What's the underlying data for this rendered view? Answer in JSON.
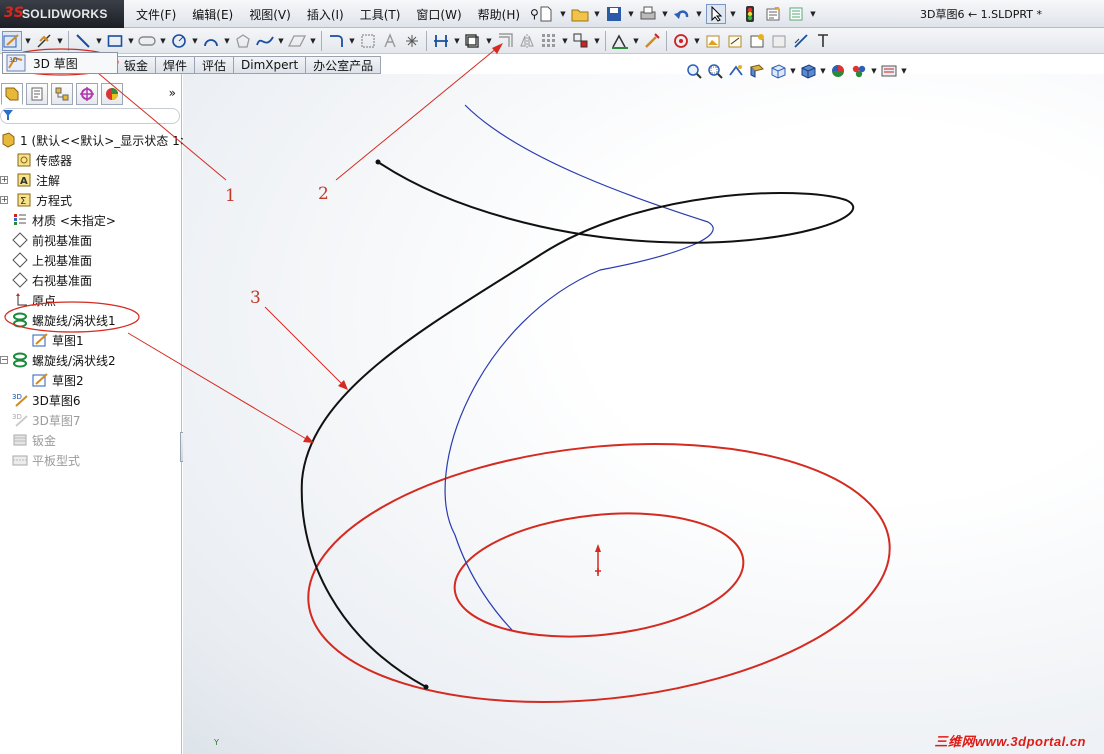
{
  "app": {
    "logo_ds": "3S",
    "logo_name": "SOLIDWORKS",
    "document_title": "3D草图6 ← 1.SLDPRT *"
  },
  "menu": {
    "items": [
      "文件(F)",
      "编辑(E)",
      "视图(V)",
      "插入(I)",
      "工具(T)",
      "窗口(W)",
      "帮助(H)"
    ]
  },
  "sketch_popup": {
    "label": "3D 草图"
  },
  "command_tabs": [
    "钣金",
    "焊件",
    "评估",
    "DimXpert",
    "办公室产品"
  ],
  "feature_tree": {
    "root": "1  (默认<<默认>_显示状态 1>",
    "items": [
      {
        "label": "传感器",
        "icon": "sensor-icon"
      },
      {
        "label": "注解",
        "icon": "annotation-icon"
      },
      {
        "label": "方程式",
        "icon": "equation-icon"
      },
      {
        "label": "材质 <未指定>",
        "icon": "material-icon"
      },
      {
        "label": "前视基准面",
        "icon": "plane-icon"
      },
      {
        "label": "上视基准面",
        "icon": "plane-icon"
      },
      {
        "label": "右视基准面",
        "icon": "plane-icon"
      },
      {
        "label": "原点",
        "icon": "origin-icon"
      },
      {
        "label": "螺旋线/涡状线1",
        "icon": "helix-icon"
      },
      {
        "label": "草图1",
        "icon": "sketch-icon"
      },
      {
        "label": "螺旋线/涡状线2",
        "icon": "helix-icon"
      },
      {
        "label": "草图2",
        "icon": "sketch-icon"
      },
      {
        "label": "3D草图6",
        "icon": "sketch3d-icon"
      },
      {
        "label": "3D草图7",
        "icon": "sketch3d-icon"
      },
      {
        "label": "钣金",
        "icon": "sheetmetal-icon"
      },
      {
        "label": "平板型式",
        "icon": "flatpattern-icon"
      }
    ]
  },
  "annotations": [
    "1",
    "2",
    "3"
  ],
  "watermark": "三维网www.3dportal.cn",
  "colors": {
    "annotation_red": "#d42a20",
    "curve_black": "#111111",
    "curve_blue": "#2b3bb0",
    "helix_green": "#1a8a3a"
  }
}
